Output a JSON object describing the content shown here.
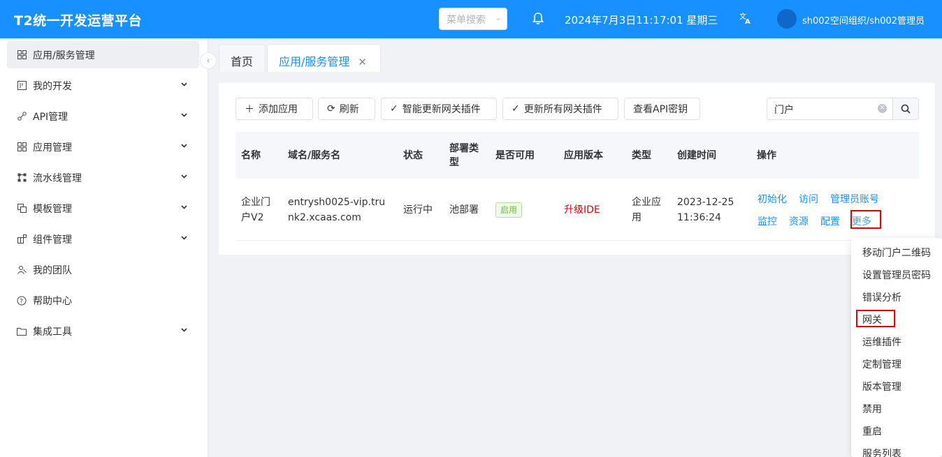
{
  "header": {
    "title": "T2统一开发运营平台",
    "menu_search_placeholder": "菜单搜索",
    "datetime": "2024年7月3日11:17:01 星期三",
    "user": "sh002空间组织/sh002管理员"
  },
  "sidebar": {
    "items": [
      {
        "label": "应用/服务管理",
        "icon": "grid-icon",
        "active": true,
        "expandable": false
      },
      {
        "label": "我的开发",
        "icon": "board-icon",
        "expandable": true
      },
      {
        "label": "API管理",
        "icon": "link-icon",
        "expandable": true
      },
      {
        "label": "应用管理",
        "icon": "apps-icon",
        "expandable": true
      },
      {
        "label": "流水线管理",
        "icon": "pipeline-icon",
        "expandable": true
      },
      {
        "label": "模板管理",
        "icon": "template-icon",
        "expandable": true
      },
      {
        "label": "组件管理",
        "icon": "component-icon",
        "expandable": true
      },
      {
        "label": "我的团队",
        "icon": "team-icon",
        "expandable": false
      },
      {
        "label": "帮助中心",
        "icon": "help-icon",
        "expandable": false
      },
      {
        "label": "集成工具",
        "icon": "folder-icon",
        "expandable": true
      }
    ]
  },
  "tabs": [
    {
      "label": "首页"
    },
    {
      "label": "应用/服务管理"
    }
  ],
  "toolbar": {
    "add_app": "添加应用",
    "refresh": "刷新",
    "smart_update": "智能更新网关插件",
    "update_all": "更新所有网关插件",
    "view_api_key": "查看API密钥",
    "search_value": "门户"
  },
  "table": {
    "headers": [
      "名称",
      "域名/服务名",
      "状态",
      "部署类型",
      "是否可用",
      "应用版本",
      "类型",
      "创建时间",
      "操作"
    ],
    "rows": [
      {
        "name": "企业门户V2",
        "domain": "entrysh0025-vip.trunk2.xcaas.com",
        "status": "运行中",
        "deploy_type": "池部署",
        "available": "启用",
        "version": "升级IDE",
        "type": "企业应用",
        "created": "2023-12-25 11:36:24",
        "actions": [
          "初始化",
          "访问",
          "管理员账号",
          "监控",
          "资源",
          "配置",
          "更多"
        ]
      }
    ]
  },
  "more_menu": [
    "移动门户二维码",
    "设置管理员密码",
    "错误分析",
    "网关",
    "运维插件",
    "定制管理",
    "版本管理",
    "禁用",
    "重启",
    "服务列表"
  ],
  "colors": {
    "primary": "#1890ff",
    "highlight": "#e60000",
    "success": "#67c23a"
  }
}
